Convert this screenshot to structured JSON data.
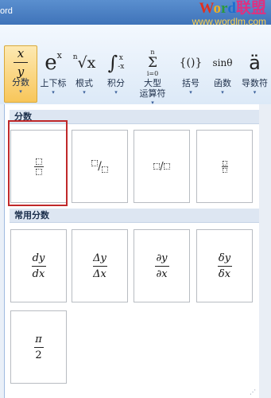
{
  "app_title": "ord",
  "watermark": {
    "logo": [
      "W",
      "o",
      "r",
      "d",
      "联盟"
    ],
    "url": "www.wordlm.com"
  },
  "ribbon": {
    "buttons": [
      {
        "id": "fraction",
        "glyph_top": "x",
        "glyph_bottom": "y",
        "label": "分数"
      },
      {
        "id": "script",
        "glyph": "e",
        "sup": "x",
        "label": "上下标"
      },
      {
        "id": "radical",
        "glyph": "√x",
        "pre": "n",
        "label": "根式"
      },
      {
        "id": "integral",
        "glyph": "∫",
        "sup": "x",
        "sub": "-x",
        "label": "积分"
      },
      {
        "id": "largeop",
        "glyph": "Σ",
        "sup": "n",
        "sub": "i=0",
        "label": "大型",
        "label2": "运算符"
      },
      {
        "id": "bracket",
        "glyph": "{()}",
        "label": "括号"
      },
      {
        "id": "function",
        "glyph": "sinθ",
        "label": "函数"
      },
      {
        "id": "accent",
        "glyph": "ä",
        "label": "导数符"
      }
    ],
    "arrow": "▾"
  },
  "panel": {
    "section1": "分数",
    "section2": "常用分数",
    "fractions": [
      {
        "id": "stacked",
        "kind": "vertical"
      },
      {
        "id": "skewed",
        "kind": "skewed",
        "sep": "/"
      },
      {
        "id": "linear",
        "kind": "linear",
        "sep": "/"
      },
      {
        "id": "small",
        "kind": "small"
      }
    ],
    "common": [
      {
        "num": "dy",
        "den": "dx"
      },
      {
        "num": "Δy",
        "den": "Δx"
      },
      {
        "num": "∂y",
        "den": "∂x"
      },
      {
        "num": "δy",
        "den": "δx"
      },
      {
        "num": "π",
        "den": "2"
      }
    ],
    "grip": "⋰"
  }
}
